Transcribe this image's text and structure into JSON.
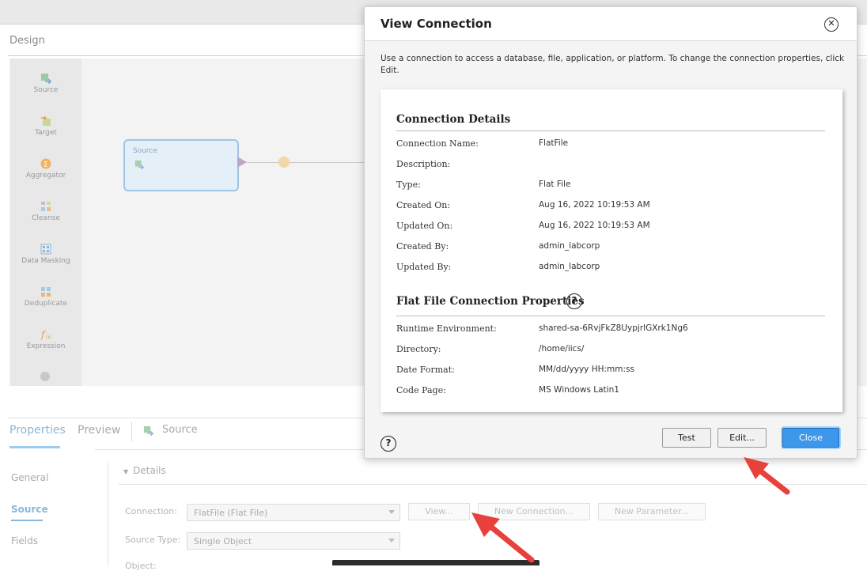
{
  "background": {
    "design_title": "Design",
    "palette": [
      {
        "label": "Source",
        "icon": "source-icon"
      },
      {
        "label": "Target",
        "icon": "target-icon"
      },
      {
        "label": "Aggregator",
        "icon": "aggregator-icon"
      },
      {
        "label": "Cleanse",
        "icon": "cleanse-icon"
      },
      {
        "label": "Data Masking",
        "icon": "data-masking-icon"
      },
      {
        "label": "Deduplicate",
        "icon": "deduplicate-icon"
      },
      {
        "label": "Expression",
        "icon": "expression-icon"
      }
    ],
    "canvas_node_label": "Source",
    "tabs": {
      "properties": "Properties",
      "preview": "Preview",
      "source": "Source"
    },
    "side_nav": {
      "general": "General",
      "source": "Source",
      "fields": "Fields"
    },
    "details_label": "Details",
    "form": {
      "connection_label": "Connection:",
      "connection_value": "FlatFile (Flat File)",
      "source_type_label": "Source Type:",
      "source_type_value": "Single Object",
      "object_label": "Object:",
      "view_button": "View...",
      "new_connection_button": "New Connection...",
      "new_parameter_button": "New Parameter..."
    }
  },
  "modal": {
    "title": "View Connection",
    "description": "Use a connection to access a database, file, application, or platform. To change the connection properties, click Edit.",
    "connection_details": {
      "title": "Connection Details",
      "rows": [
        {
          "label": "Connection Name:",
          "value": "FlatFile"
        },
        {
          "label": "Description:",
          "value": ""
        },
        {
          "label": "Type:",
          "value": "Flat File"
        },
        {
          "label": "Created On:",
          "value": "Aug 16, 2022 10:19:53 AM"
        },
        {
          "label": "Updated On:",
          "value": "Aug 16, 2022 10:19:53 AM"
        },
        {
          "label": "Created By:",
          "value": "admin_labcorp"
        },
        {
          "label": "Updated By:",
          "value": "admin_labcorp"
        }
      ]
    },
    "flat_file_properties": {
      "title": "Flat File Connection Properties",
      "rows": [
        {
          "label": "Runtime Environment:",
          "value": "shared-sa-6RvjFkZ8UypjrlGXrk1Ng6"
        },
        {
          "label": "Directory:",
          "value": "/home/iics/"
        },
        {
          "label": "Date Format:",
          "value": "MM/dd/yyyy HH:mm:ss"
        },
        {
          "label": "Code Page:",
          "value": "MS Windows Latin1"
        }
      ]
    },
    "buttons": {
      "test": "Test",
      "edit": "Edit...",
      "close": "Close"
    }
  },
  "colors": {
    "primary_button": "#3d97ea",
    "annotation_arrow": "#e8403a"
  }
}
